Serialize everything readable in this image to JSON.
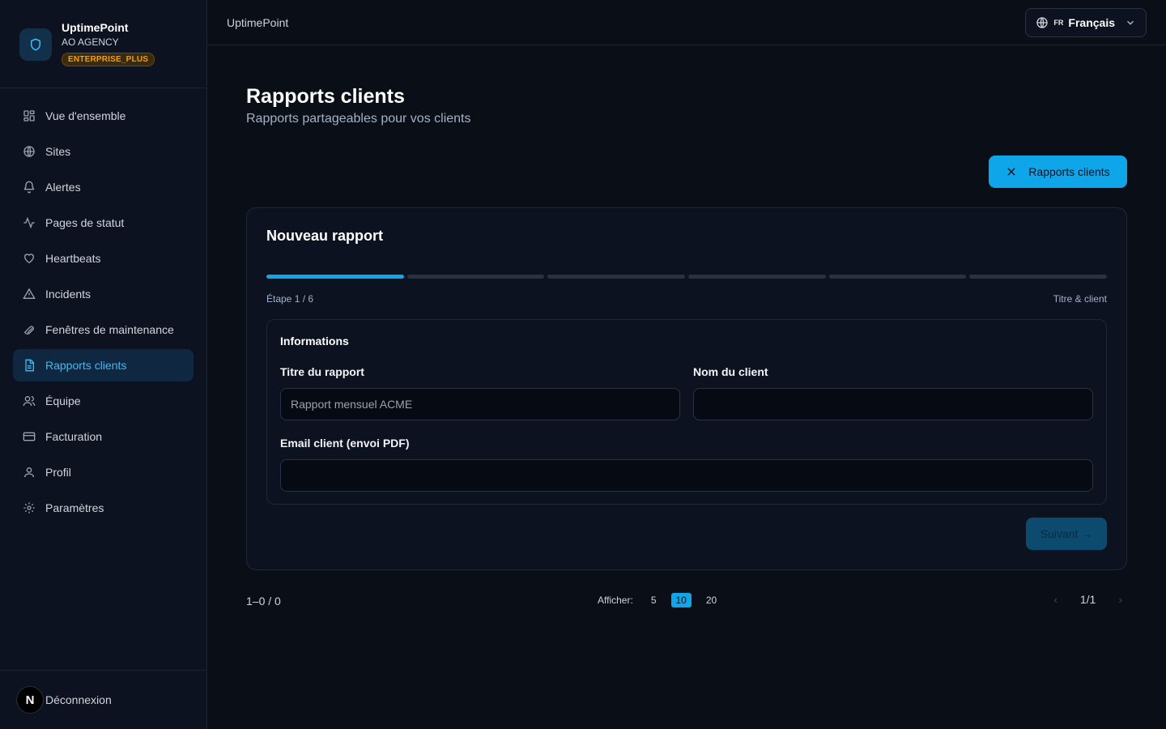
{
  "brand": {
    "name": "UptimePoint",
    "agency": "AO AGENCY",
    "plan": "ENTERPRISE_PLUS"
  },
  "sidebar": {
    "items": [
      {
        "label": "Vue d'ensemble",
        "icon": "grid-icon"
      },
      {
        "label": "Sites",
        "icon": "globe-icon"
      },
      {
        "label": "Alertes",
        "icon": "bell-icon"
      },
      {
        "label": "Pages de statut",
        "icon": "activity-icon"
      },
      {
        "label": "Heartbeats",
        "icon": "heart-icon"
      },
      {
        "label": "Incidents",
        "icon": "warning-icon"
      },
      {
        "label": "Fenêtres de maintenance",
        "icon": "wrench-icon"
      },
      {
        "label": "Rapports clients",
        "icon": "document-icon",
        "active": true
      },
      {
        "label": "Équipe",
        "icon": "users-icon"
      },
      {
        "label": "Facturation",
        "icon": "credit-card-icon"
      },
      {
        "label": "Profil",
        "icon": "user-icon"
      },
      {
        "label": "Paramètres",
        "icon": "gear-icon"
      }
    ],
    "logout": {
      "avatar": "N",
      "label": "Déconnexion"
    }
  },
  "topbar": {
    "title": "UptimePoint",
    "language": {
      "code": "FR",
      "name": "Français"
    }
  },
  "main": {
    "title": "Rapports clients",
    "subtitle": "Rapports partageables pour vos clients",
    "header_button": "Rapports clients"
  },
  "wizard": {
    "title": "Nouveau rapport",
    "current_step": 1,
    "total_steps": 6,
    "step_label": "Étape 1 / 6",
    "step_name": "Titre & client",
    "section_title": "Informations",
    "fields": {
      "report_title": {
        "label": "Titre du rapport",
        "value": "",
        "placeholder": "Rapport mensuel ACME"
      },
      "client_name": {
        "label": "Nom du client",
        "value": "",
        "placeholder": ""
      },
      "client_email": {
        "label": "Email client (envoi PDF)",
        "value": "",
        "placeholder": ""
      }
    },
    "next_button": "Suivant →"
  },
  "pagination": {
    "count": "1–0 / 0",
    "show_label": "Afficher:",
    "sizes": [
      "5",
      "10",
      "20"
    ],
    "selected_size": "10",
    "page_indicator": "1/1",
    "prev": "‹",
    "next": "›"
  },
  "colors": {
    "accent": "#0ea5e9",
    "background": "#0a0e17",
    "sidebar": "#0c1220",
    "plan_badge": "#f59e0b"
  }
}
